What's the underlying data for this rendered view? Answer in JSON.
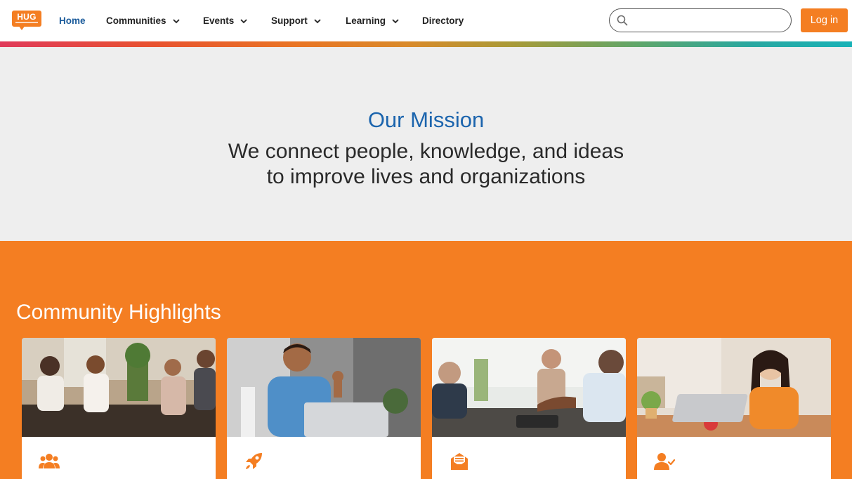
{
  "brand": {
    "logo_text": "HUG",
    "accent_color": "#f47e22",
    "link_color": "#1b64ad"
  },
  "nav": {
    "home": "Home",
    "communities": "Communities",
    "events": "Events",
    "support": "Support",
    "learning": "Learning",
    "directory": "Directory"
  },
  "search": {
    "placeholder": "",
    "icon": "search-icon"
  },
  "login_label": "Log in",
  "mission": {
    "title": "Our Mission",
    "line1": "We connect people, knowledge, and ideas",
    "line2": "to improve lives and organizations"
  },
  "highlights": {
    "title": "Community Highlights",
    "cards": [
      {
        "photo": "group of colleagues laughing on a couch",
        "icon": "users-icon"
      },
      {
        "photo": "man waving at laptop on video call",
        "icon": "rocket-icon"
      },
      {
        "photo": "business people discussing at a table",
        "icon": "envelope-open-icon"
      },
      {
        "photo": "woman smiling while working on laptop",
        "icon": "user-check-icon"
      }
    ]
  }
}
